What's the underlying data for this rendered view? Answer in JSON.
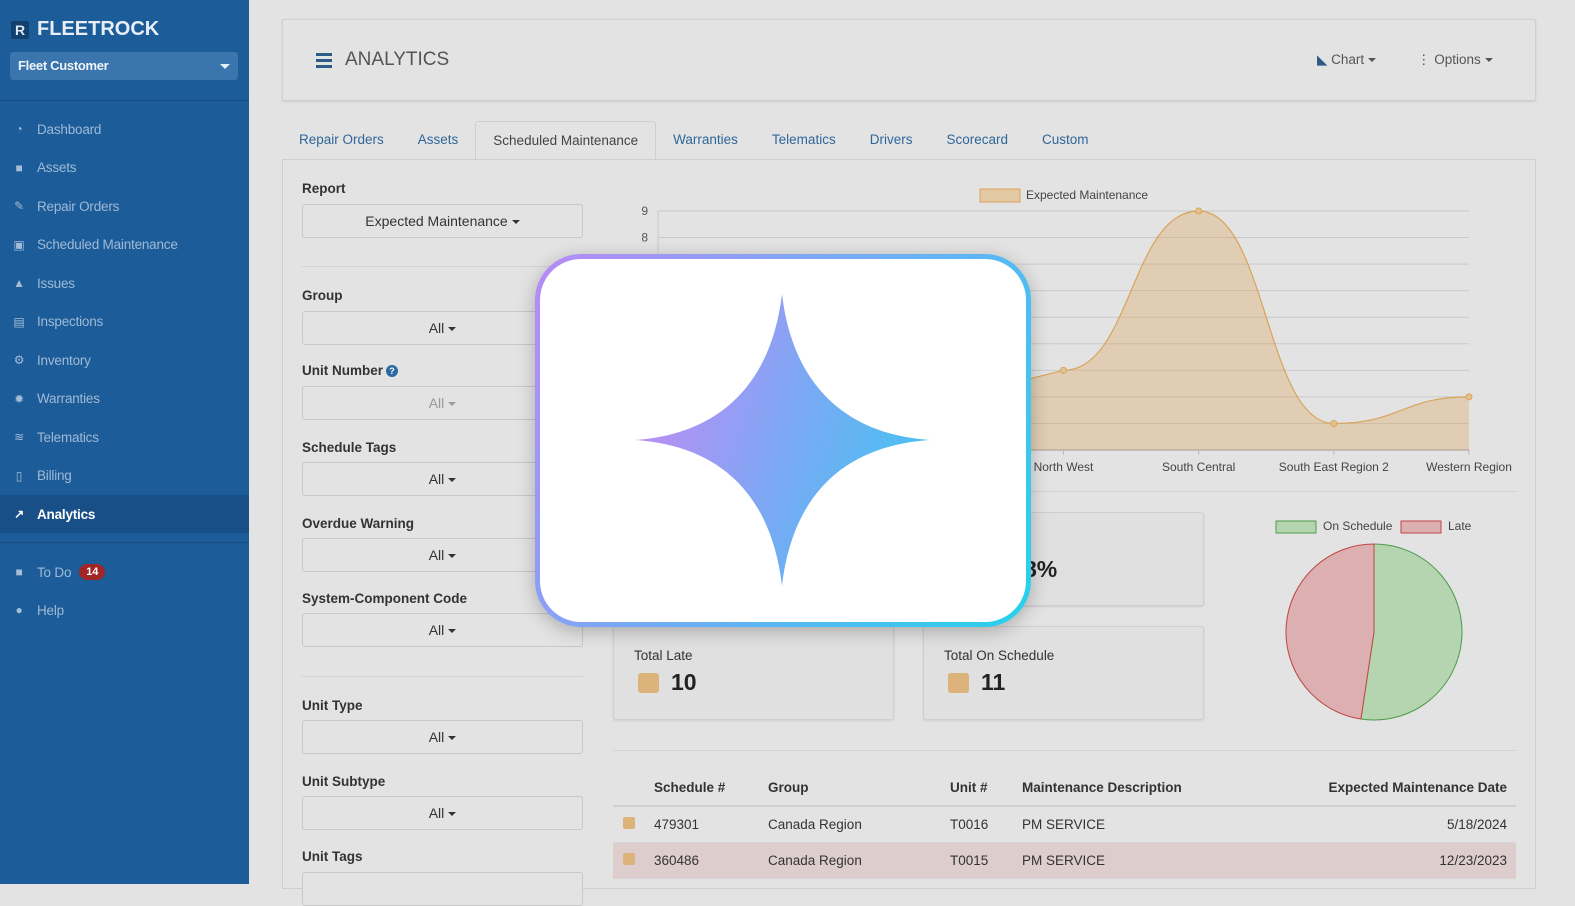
{
  "brand": "FLEETROCK",
  "brand_mark": "R",
  "customer_select": "Fleet Customer",
  "nav": [
    {
      "label": "Dashboard",
      "icon": "dashboard-icon",
      "glyph": "◔"
    },
    {
      "label": "Assets",
      "icon": "truck-icon",
      "glyph": "■"
    },
    {
      "label": "Repair Orders",
      "icon": "wrench-icon",
      "glyph": "✎"
    },
    {
      "label": "Scheduled Maintenance",
      "icon": "calendar-check-icon",
      "glyph": "▣"
    },
    {
      "label": "Issues",
      "icon": "warning-icon",
      "glyph": "▲"
    },
    {
      "label": "Inspections",
      "icon": "list-icon",
      "glyph": "▤"
    },
    {
      "label": "Inventory",
      "icon": "cogs-icon",
      "glyph": "⚙"
    },
    {
      "label": "Warranties",
      "icon": "certificate-icon",
      "glyph": "✹"
    },
    {
      "label": "Telematics",
      "icon": "wifi-icon",
      "glyph": "≋"
    },
    {
      "label": "Billing",
      "icon": "file-icon",
      "glyph": "▯"
    },
    {
      "label": "Analytics",
      "icon": "line-chart-icon",
      "glyph": "↗"
    }
  ],
  "todo": {
    "label": "To Do",
    "count": "14"
  },
  "help": "Help",
  "header": {
    "title": "ANALYTICS",
    "chart": "Chart",
    "options": "Options"
  },
  "tabs": [
    "Repair Orders",
    "Assets",
    "Scheduled Maintenance",
    "Warranties",
    "Telematics",
    "Drivers",
    "Scorecard",
    "Custom"
  ],
  "filters": {
    "report_label": "Report",
    "report_value": "Expected Maintenance",
    "group_label": "Group",
    "group_value": "All",
    "unit_label": "Unit Number",
    "unit_value": "All",
    "tags_label": "Schedule Tags",
    "tags_value": "All",
    "overdue_label": "Overdue Warning",
    "overdue_value": "All",
    "syscode_label": "System-Component Code",
    "syscode_value": "All",
    "unittype_label": "Unit Type",
    "unittype_value": "All",
    "subtype_label": "Unit Subtype",
    "subtype_value": "All",
    "unittags_label": "Unit Tags"
  },
  "stats": {
    "pct_partial": "8%",
    "late_label": "Total Late",
    "late_value": "10",
    "ontime_label": "Total On Schedule",
    "ontime_value": "11"
  },
  "chart_data": [
    {
      "type": "area",
      "title": "",
      "legend": [
        "Expected Maintenance"
      ],
      "legend_position": "top-center",
      "categories": [
        "North West",
        "South Central",
        "South East Region 2",
        "Western Region"
      ],
      "hidden_leading_categories": 3,
      "values": [
        3,
        9,
        1,
        2
      ],
      "y_ticks": [
        "9",
        "8"
      ],
      "ylim": [
        0,
        9
      ],
      "grid": true,
      "color": "#d9a45a"
    },
    {
      "type": "pie",
      "legend": [
        "On Schedule",
        "Late"
      ],
      "legend_position": "top",
      "values": [
        11,
        10
      ],
      "colors": [
        "#b5d5b1",
        "#dcb0b0"
      ],
      "stroke": [
        "#4c9a4c",
        "#c04545"
      ]
    }
  ],
  "table": {
    "headers": [
      "Schedule #",
      "Group",
      "Unit #",
      "Maintenance Description",
      "Expected Maintenance Date"
    ],
    "rows": [
      {
        "schedule": "479301",
        "group": "Canada Region",
        "unit": "T0016",
        "desc": "PM SERVICE",
        "date": "5/18/2024",
        "late": false
      },
      {
        "schedule": "360486",
        "group": "Canada Region",
        "unit": "T0015",
        "desc": "PM SERVICE",
        "date": "12/23/2023",
        "late": true
      }
    ]
  }
}
